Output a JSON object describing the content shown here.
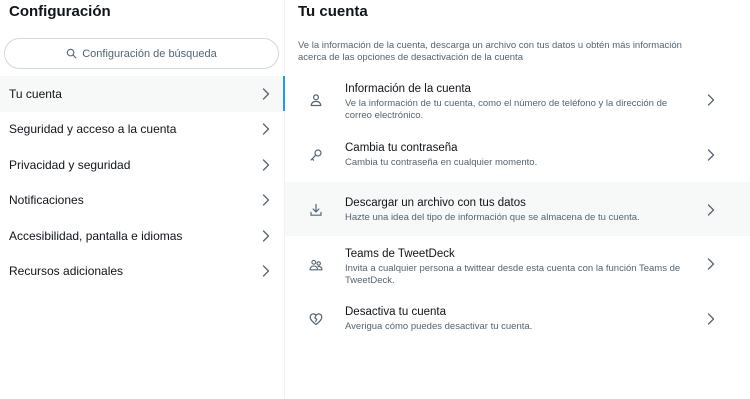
{
  "settings": {
    "title": "Configuración",
    "search_placeholder": "Configuración de búsqueda",
    "nav": [
      {
        "label": "Tu cuenta",
        "active": true
      },
      {
        "label": "Seguridad y acceso a la cuenta"
      },
      {
        "label": "Privacidad y seguridad"
      },
      {
        "label": "Notificaciones"
      },
      {
        "label": "Accesibilidad, pantalla e idiomas"
      },
      {
        "label": "Recursos adicionales"
      }
    ]
  },
  "account": {
    "title": "Tu cuenta",
    "intro": "Ve la información de la cuenta, descarga un archivo con tus datos u obtén más información acerca de las opciones de desactivación de la cuenta",
    "options": [
      {
        "icon": "person-icon",
        "title": "Información de la cuenta",
        "desc": "Ve la información de tu cuenta, como el número de teléfono y la dirección de correo electrónico."
      },
      {
        "icon": "key-icon",
        "title": "Cambia tu contraseña",
        "desc": "Cambia tu contraseña en cualquier momento."
      },
      {
        "icon": "download-icon",
        "title": "Descargar un archivo con tus datos",
        "desc": "Hazte una idea del tipo de información que se almacena de tu cuenta."
      },
      {
        "icon": "people-icon",
        "title": "Teams de TweetDeck",
        "desc": "Invita a cualquier persona a twittear desde esta cuenta con la función Teams de TweetDeck."
      },
      {
        "icon": "broken-heart-icon",
        "title": "Desactiva tu cuenta",
        "desc": "Averigua cómo puedes desactivar tu cuenta."
      }
    ]
  },
  "colors": {
    "accent": "#1d9bf0",
    "text": "#0f1419",
    "secondary": "#536471",
    "hover": "#f7f9f9"
  }
}
